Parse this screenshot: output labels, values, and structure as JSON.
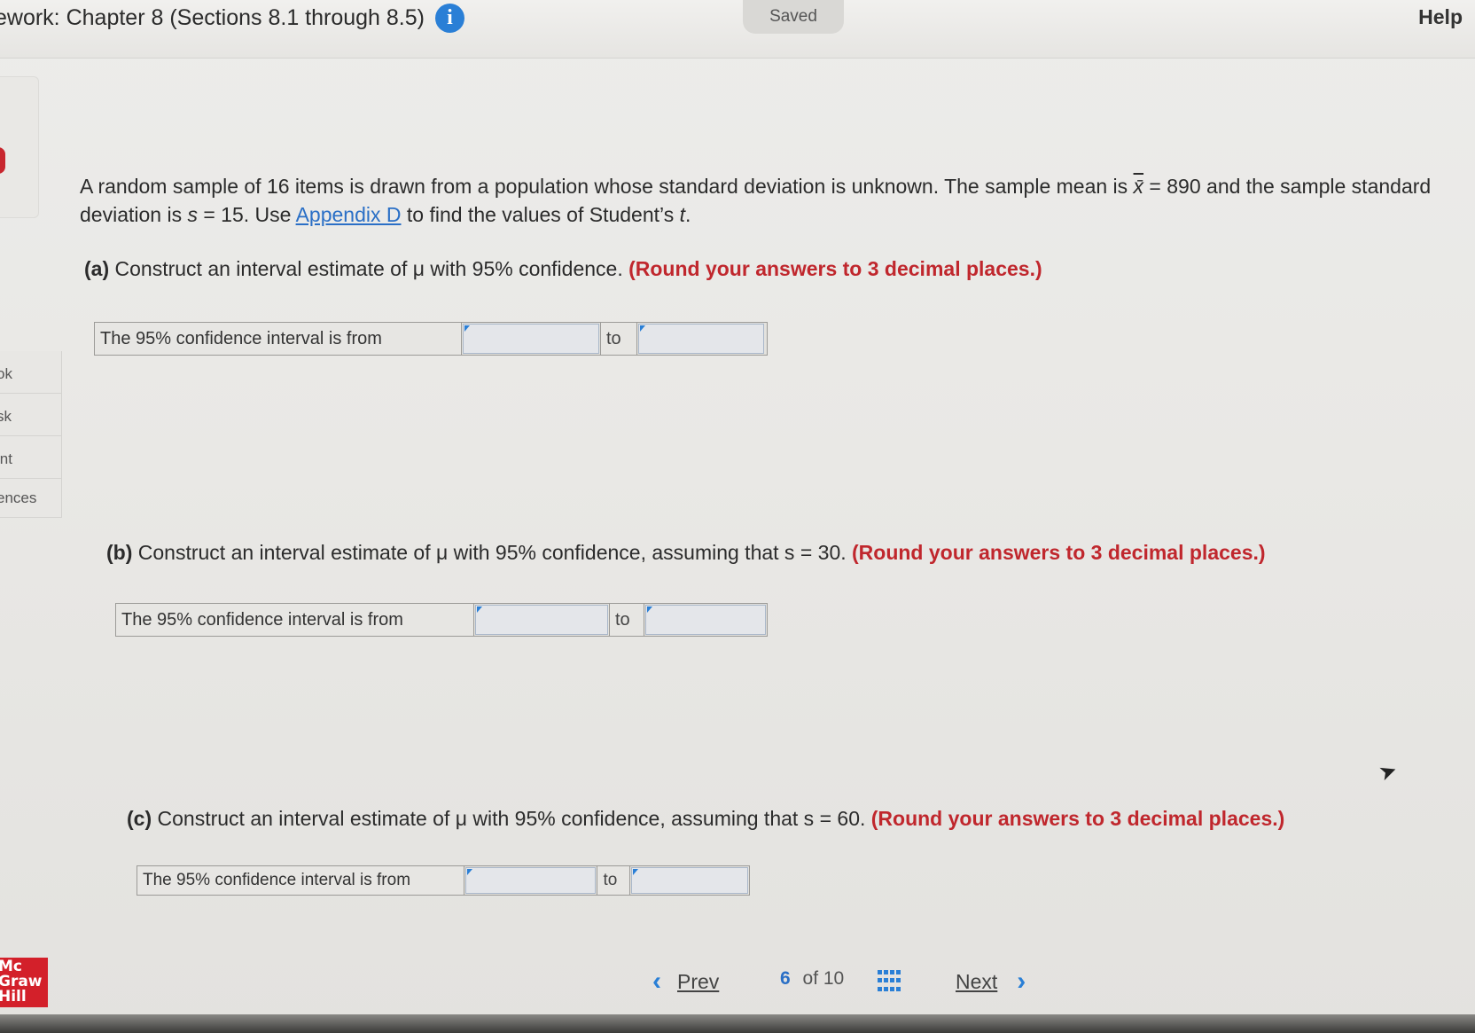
{
  "header": {
    "title": "ework: Chapter 8 (Sections 8.1 through 8.5)",
    "info_icon": "i",
    "saved": "Saved",
    "help": "Help"
  },
  "sidebar": {
    "items": [
      {
        "label": "ok"
      },
      {
        "label": "sk"
      },
      {
        "label": "int"
      },
      {
        "label": "ences"
      }
    ]
  },
  "question": {
    "intro_1": "A random sample of 16 items is drawn from a population whose standard deviation is unknown. The sample mean is ",
    "xbar_symbol": "x̄",
    "intro_2": " = 890 and the sample standard deviation is ",
    "s_symbol": "s",
    "intro_3": " = 15. Use ",
    "appendix_link": "Appendix D",
    "intro_4": " to find the values of Student’s ",
    "t_symbol": "t",
    "intro_5": ".",
    "parts": [
      {
        "label": "(a)",
        "text": " Construct an interval estimate of μ with 95% confidence. ",
        "round_note": "(Round your answers to 3 decimal places.)",
        "row_label": "The 95% confidence interval is from",
        "to_label": "to",
        "value_from": "",
        "value_to": ""
      },
      {
        "label": "(b)",
        "text": " Construct an interval estimate of μ with 95% confidence, assuming that s = 30. ",
        "round_note": "(Round your answers to 3 decimal places.)",
        "row_label": "The 95% confidence interval is from",
        "to_label": "to",
        "value_from": "",
        "value_to": ""
      },
      {
        "label": "(c)",
        "text": " Construct an interval estimate of μ with 95% confidence, assuming that s = 60. ",
        "round_note": "(Round your answers to 3 decimal places.)",
        "row_label": "The 95% confidence interval is from",
        "to_label": "to",
        "value_from": "",
        "value_to": ""
      }
    ]
  },
  "footer": {
    "logo_lines": [
      "Mc",
      "Graw",
      "Hill"
    ],
    "prev": "Prev",
    "current_page": "6",
    "of_text": "of 10",
    "next": "Next",
    "prev_chevron": "‹",
    "next_chevron": "›"
  },
  "colors": {
    "accent": "#2a7fd6",
    "round_note": "#c0272d",
    "logo": "#d3202a"
  }
}
